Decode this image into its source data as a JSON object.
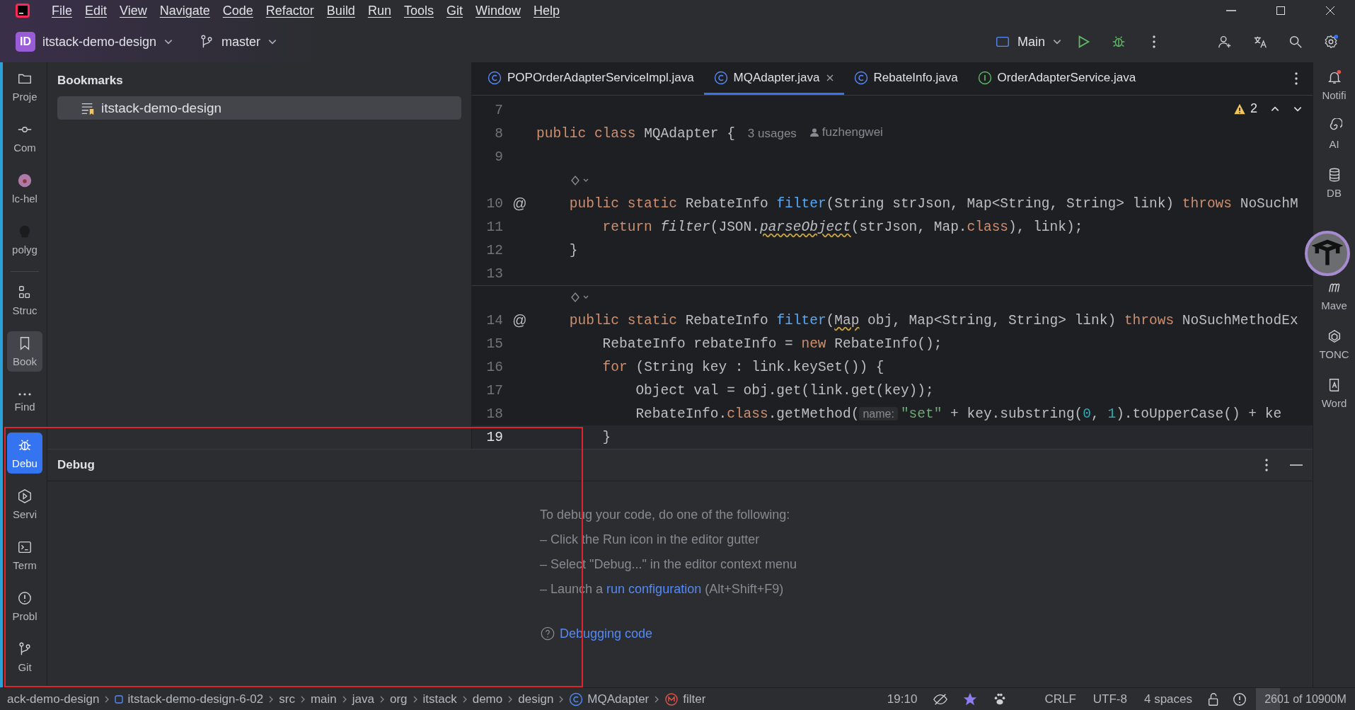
{
  "menu": [
    "File",
    "Edit",
    "View",
    "Navigate",
    "Code",
    "Refactor",
    "Build",
    "Run",
    "Tools",
    "Git",
    "Window",
    "Help"
  ],
  "toolbar": {
    "project_badge": "ID",
    "project": "itstack-demo-design",
    "branch": "master",
    "run_config": "Main"
  },
  "left_tools": [
    {
      "label": "Proje",
      "selected": false
    },
    {
      "label": "Com",
      "selected": false
    },
    {
      "label": "lc-hel",
      "selected": false
    },
    {
      "label": "polyg",
      "selected": false
    },
    {
      "label": "Struc",
      "selected": false
    },
    {
      "label": "Book",
      "selected": true
    },
    {
      "label": "Find",
      "selected": false
    }
  ],
  "left_tools_bottom": [
    {
      "label": "Debu",
      "selected": true
    },
    {
      "label": "Servi",
      "selected": false
    },
    {
      "label": "Term",
      "selected": false
    },
    {
      "label": "Probl",
      "selected": false
    },
    {
      "label": "Git",
      "selected": false
    }
  ],
  "bookmarks": {
    "title": "Bookmarks",
    "items": [
      {
        "label": "itstack-demo-design",
        "selected": true
      }
    ]
  },
  "editor": {
    "tabs": [
      {
        "label": "POPOrderAdapterServiceImpl.java",
        "kind": "class",
        "selected": false,
        "closable": false
      },
      {
        "label": "MQAdapter.java",
        "kind": "class",
        "selected": true,
        "closable": true
      },
      {
        "label": "RebateInfo.java",
        "kind": "class",
        "selected": false,
        "closable": false
      },
      {
        "label": "OrderAdapterService.java",
        "kind": "interface",
        "selected": false,
        "closable": false
      }
    ],
    "warnings": "2",
    "lines": [
      {
        "number": "7"
      },
      {
        "number": "8",
        "segments": [
          {
            "text": "public class ",
            "kind": "kw"
          },
          {
            "text": "MQAdapter {",
            "kind": "plain"
          },
          {
            "text": "3 usages",
            "kind": "usage"
          },
          {
            "text": "fuzhengwei",
            "kind": "author"
          }
        ]
      },
      {
        "number": "9"
      },
      {
        "kind": "gutter-icons",
        "separator": false
      },
      {
        "number": "10",
        "marker": "@",
        "segments": [
          {
            "text": "    public static ",
            "kind": "kw"
          },
          {
            "text": "RebateInfo ",
            "kind": "plain"
          },
          {
            "text": "filter",
            "kind": "fn"
          },
          {
            "text": "(String strJson, Map<String, String> link) ",
            "kind": "plain"
          },
          {
            "text": "throws",
            "kind": "kw"
          },
          {
            "text": " NoSuchM",
            "kind": "plain"
          }
        ]
      },
      {
        "number": "11",
        "segments": [
          {
            "text": "        return ",
            "kind": "kw"
          },
          {
            "text": "filter",
            "kind": "static"
          },
          {
            "text": "(JSON.",
            "kind": "plain"
          },
          {
            "text": "parseObject",
            "kind": "static-warn"
          },
          {
            "text": "(strJson, Map.",
            "kind": "plain"
          },
          {
            "text": "class",
            "kind": "kw"
          },
          {
            "text": "), link);",
            "kind": "plain"
          }
        ]
      },
      {
        "number": "12",
        "segments": [
          {
            "text": "    }",
            "kind": "plain"
          }
        ]
      },
      {
        "number": "13"
      },
      {
        "kind": "gutter-icons",
        "separator": true
      },
      {
        "number": "14",
        "marker": "@",
        "segments": [
          {
            "text": "    public static ",
            "kind": "kw"
          },
          {
            "text": "RebateInfo ",
            "kind": "plain"
          },
          {
            "text": "filter",
            "kind": "fn"
          },
          {
            "text": "(",
            "kind": "plain"
          },
          {
            "text": "Map",
            "kind": "warn"
          },
          {
            "text": " obj, Map<String, String> link) ",
            "kind": "plain"
          },
          {
            "text": "throws",
            "kind": "kw"
          },
          {
            "text": " NoSuchMethodEx",
            "kind": "plain"
          }
        ]
      },
      {
        "number": "15",
        "segments": [
          {
            "text": "        RebateInfo rebateInfo = ",
            "kind": "plain"
          },
          {
            "text": "new",
            "kind": "kw"
          },
          {
            "text": " RebateInfo();",
            "kind": "plain"
          }
        ]
      },
      {
        "number": "16",
        "segments": [
          {
            "text": "        for",
            "kind": "kw"
          },
          {
            "text": " (String key : link.keySet()) {",
            "kind": "plain"
          }
        ]
      },
      {
        "number": "17",
        "segments": [
          {
            "text": "            Object val = obj.get(link.get(key));",
            "kind": "plain"
          }
        ]
      },
      {
        "number": "18",
        "segments": [
          {
            "text": "            RebateInfo.",
            "kind": "plain"
          },
          {
            "text": "class",
            "kind": "kw"
          },
          {
            "text": ".getMethod(",
            "kind": "plain"
          },
          {
            "text": "name:",
            "kind": "hint"
          },
          {
            "text": "\"set\"",
            "kind": "str"
          },
          {
            "text": " + key.substring(",
            "kind": "plain"
          },
          {
            "text": "0",
            "kind": "num"
          },
          {
            "text": ", ",
            "kind": "plain"
          },
          {
            "text": "1",
            "kind": "num"
          },
          {
            "text": ").toUpperCase() + ke",
            "kind": "plain"
          }
        ]
      },
      {
        "number": "19",
        "current": true,
        "segments": [
          {
            "text": "        }",
            "kind": "plain"
          }
        ]
      }
    ]
  },
  "right_tools": [
    {
      "label": "Notifi"
    },
    {
      "label": "AI"
    },
    {
      "label": "DB"
    },
    {
      "label": "Mave"
    },
    {
      "label": "TONC"
    },
    {
      "label": "Word"
    }
  ],
  "debug": {
    "title": "Debug",
    "intro": "To debug your code, do one of the following:",
    "steps": [
      {
        "text": "– Click the Run icon in the editor gutter"
      },
      {
        "text": "– Select \"Debug...\" in the editor context menu"
      },
      {
        "text": "– Launch a ",
        "link": "run configuration",
        "suffix": " (Alt+Shift+F9)"
      }
    ],
    "help_link": "Debugging code"
  },
  "status_bar": {
    "breadcrumbs": [
      {
        "label": "ack-demo-design",
        "kind": "plain"
      },
      {
        "label": "itstack-demo-design-6-02",
        "kind": "module"
      },
      {
        "label": "src",
        "kind": "plain"
      },
      {
        "label": "main",
        "kind": "plain"
      },
      {
        "label": "java",
        "kind": "plain"
      },
      {
        "label": "org",
        "kind": "plain"
      },
      {
        "label": "itstack",
        "kind": "plain"
      },
      {
        "label": "demo",
        "kind": "plain"
      },
      {
        "label": "design",
        "kind": "plain"
      },
      {
        "label": "MQAdapter",
        "kind": "class"
      },
      {
        "label": "filter",
        "kind": "method"
      }
    ],
    "position": "19:10",
    "line_separator": "CRLF",
    "encoding": "UTF-8",
    "indent": "4 spaces",
    "memory": {
      "text": "2601 of 10900M",
      "level": 0.24
    }
  }
}
